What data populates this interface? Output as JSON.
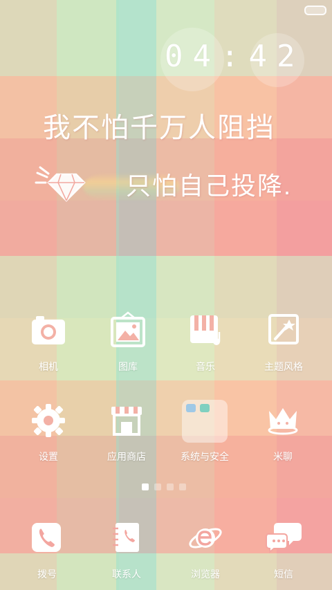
{
  "clock": {
    "time": "04:42"
  },
  "quote": {
    "line1": "我不怕千万人阻挡",
    "line2": "只怕自己投降."
  },
  "home_apps": [
    {
      "label": "相机",
      "icon": "camera-icon"
    },
    {
      "label": "图库",
      "icon": "gallery-icon"
    },
    {
      "label": "音乐",
      "icon": "music-icon"
    },
    {
      "label": "主题风格",
      "icon": "theme-icon"
    },
    {
      "label": "设置",
      "icon": "settings-gear-icon"
    },
    {
      "label": "应用商店",
      "icon": "app-store-icon"
    },
    {
      "label": "系统与安全",
      "icon": "folder-icon"
    },
    {
      "label": "米聊",
      "icon": "crown-chat-icon"
    }
  ],
  "dock_apps": [
    {
      "label": "拨号",
      "icon": "phone-icon"
    },
    {
      "label": "联系人",
      "icon": "contacts-icon"
    },
    {
      "label": "浏览器",
      "icon": "browser-icon"
    },
    {
      "label": "短信",
      "icon": "messages-icon"
    }
  ],
  "pager": {
    "pages": 4,
    "current": 1
  },
  "colors": {
    "wall_green": "#cfe9c2",
    "wall_peach": "#f7c7a9",
    "wall_pink": "#f3a3a1",
    "wall_mint": "#a9e3cf",
    "accent_white": "#ffffff"
  }
}
